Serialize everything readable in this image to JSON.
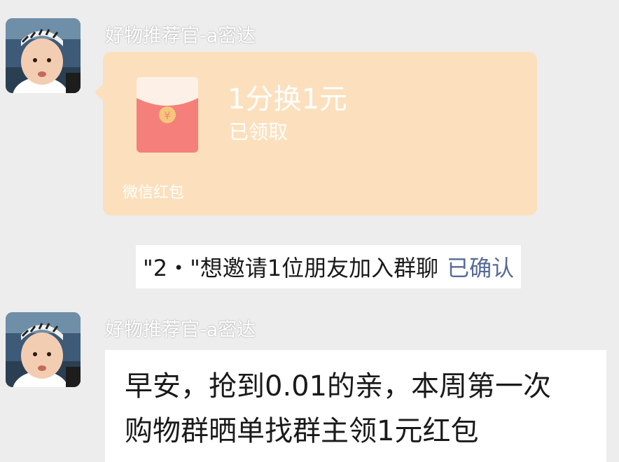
{
  "messages": [
    {
      "sender": "好物推荐官-a密达",
      "avatar": "baby-avatar",
      "type": "red_packet",
      "red_packet": {
        "title": "1分换1元",
        "status": "已领取",
        "brand": "微信红包",
        "icon": "red-envelope-icon"
      }
    },
    {
      "type": "system",
      "text": "\"2・\"想邀请1位朋友加入群聊",
      "action": "已确认"
    },
    {
      "sender": "好物推荐官-a密达",
      "avatar": "baby-avatar",
      "type": "text",
      "lines": [
        "早安，抢到0.01的亲，本周第一次",
        "购物群晒单找群主领1元红包"
      ]
    }
  ],
  "colors": {
    "background": "#ededed",
    "red_packet_bg": "#fce0bd",
    "envelope_red": "#f57f7a",
    "link_blue": "#576b95",
    "bubble_bg": "#ffffff"
  }
}
